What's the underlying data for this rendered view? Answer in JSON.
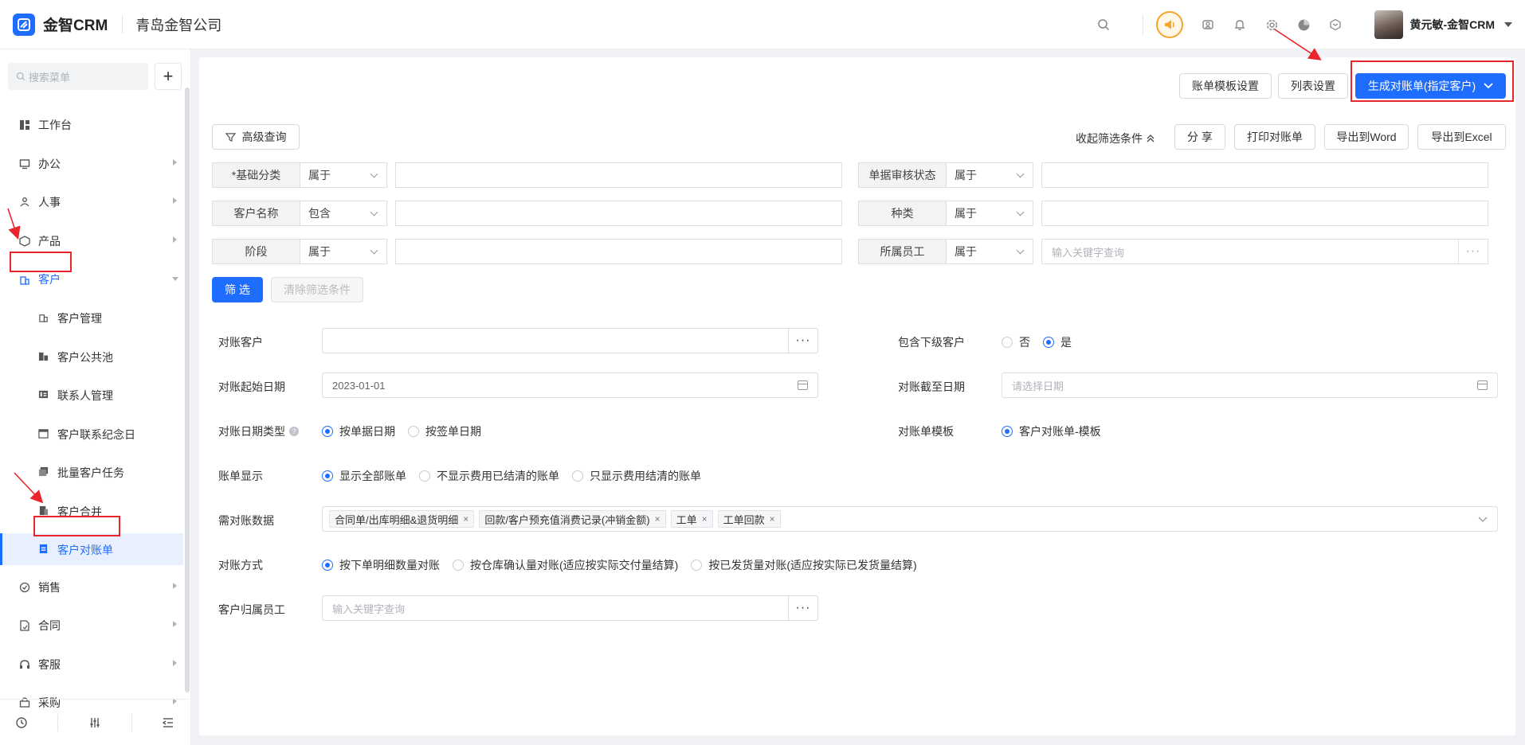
{
  "brand": {
    "name": "金智CRM",
    "company": "青岛金智公司",
    "accent": "#1f6dff",
    "highlight": "#e8262b"
  },
  "user": {
    "name": "黄元敏-金智CRM"
  },
  "top_icons": [
    "search-icon",
    "speaker-icon",
    "contacts-icon",
    "bell-icon",
    "gear-icon",
    "pie-chart-icon",
    "cube-icon"
  ],
  "sidebar": {
    "search_placeholder": "搜索菜单",
    "plus": "+",
    "items": [
      {
        "label": "工作台",
        "icon": "dashboard-icon"
      },
      {
        "label": "办公",
        "icon": "monitor-icon"
      },
      {
        "label": "人事",
        "icon": "people-icon"
      },
      {
        "label": "产品",
        "icon": "box-icon"
      },
      {
        "label": "客户",
        "icon": "building-icon"
      }
    ],
    "sub_items": [
      {
        "label": "客户管理"
      },
      {
        "label": "客户公共池"
      },
      {
        "label": "联系人管理"
      },
      {
        "label": "客户联系纪念日"
      },
      {
        "label": "批量客户任务"
      },
      {
        "label": "客户合并"
      },
      {
        "label": "客户对账单"
      }
    ],
    "items_after": [
      {
        "label": "销售"
      },
      {
        "label": "合同"
      },
      {
        "label": "客服"
      },
      {
        "label": "采购"
      }
    ]
  },
  "toolbar": {
    "template_settings": "账单模板设置",
    "list_settings": "列表设置",
    "generate": "生成对账单(指定客户)"
  },
  "filter_bar": {
    "advanced": "高级查询",
    "collapse": "收起筛选条件",
    "share": "分 享",
    "print": "打印对账单",
    "export_word": "导出到Word",
    "export_excel": "导出到Excel"
  },
  "filters": [
    {
      "label": "*基础分类",
      "op": "属于",
      "value": ""
    },
    {
      "label": "单据审核状态",
      "op": "属于",
      "value": ""
    },
    {
      "label": "客户名称",
      "op": "包含",
      "value": ""
    },
    {
      "label": "种类",
      "op": "属于",
      "value": ""
    },
    {
      "label": "阶段",
      "op": "属于",
      "value": ""
    },
    {
      "label": "所属员工",
      "op": "属于",
      "placeholder": "输入关键字查询",
      "dots": "···"
    }
  ],
  "filter_actions": {
    "apply": "筛 选",
    "clear": "清除筛选条件"
  },
  "form": {
    "customer_label": "对账客户",
    "customer_dots": "···",
    "include_sub_label": "包含下级客户",
    "include_sub_options": [
      "否",
      "是"
    ],
    "include_sub_selected": 1,
    "start_date_label": "对账起始日期",
    "start_date_value": "2023-01-01",
    "end_date_label": "对账截至日期",
    "end_date_placeholder": "请选择日期",
    "date_type_label": "对账日期类型",
    "date_type_options": [
      "按单据日期",
      "按签单日期"
    ],
    "date_type_selected": 0,
    "template_label": "对账单模板",
    "template_options": [
      "客户对账单-模板"
    ],
    "template_selected": 0,
    "display_label": "账单显示",
    "display_options": [
      "显示全部账单",
      "不显示费用已结清的账单",
      "只显示费用结清的账单"
    ],
    "display_selected": 0,
    "data_label": "需对账数据",
    "data_tags": [
      "合同单/出库明细&退货明细",
      "回款/客户预充值消费记录(冲销金额)",
      "工单",
      "工单回款"
    ],
    "method_label": "对账方式",
    "method_options": [
      "按下单明细数量对账",
      "按仓库确认量对账(适应按实际交付量结算)",
      "按已发货量对账(适应按实际已发货量结算)"
    ],
    "method_selected": 0,
    "owner_label": "客户归属员工",
    "owner_placeholder": "输入关键字查询",
    "owner_dots": "···"
  }
}
